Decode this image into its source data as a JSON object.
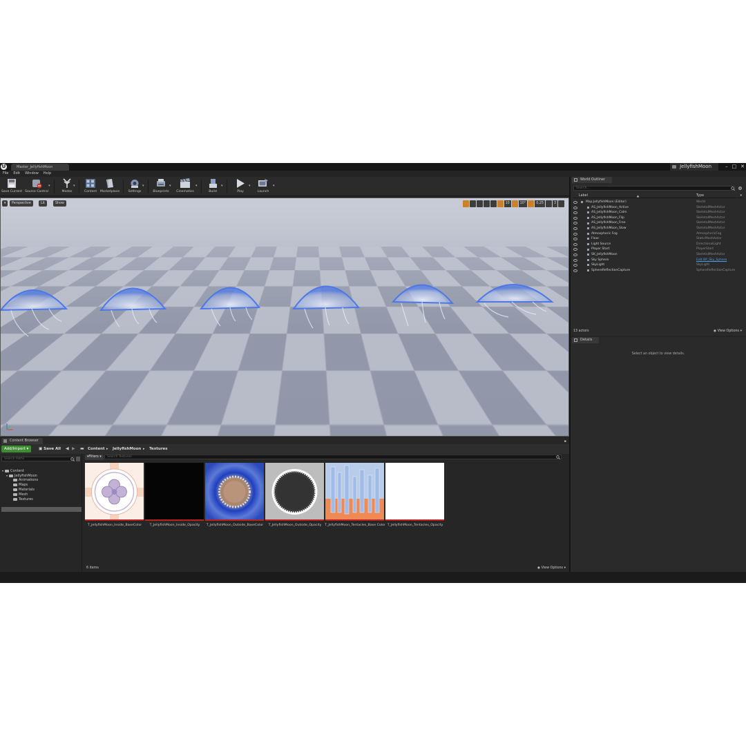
{
  "window": {
    "tab_title": "Master_JellyfishMoon",
    "project_name": "JellyfishMoon",
    "controls": [
      "–",
      "□",
      "✕"
    ]
  },
  "menu": [
    "File",
    "Edit",
    "Window",
    "Help"
  ],
  "toolbar": {
    "items": [
      {
        "label": "Save Current",
        "icon": "save-icon"
      },
      {
        "label": "Source Control",
        "icon": "source-control-icon"
      },
      {
        "label": "Modes",
        "icon": "modes-icon"
      },
      {
        "label": "Content",
        "icon": "content-icon"
      },
      {
        "label": "Marketplace",
        "icon": "marketplace-icon"
      },
      {
        "label": "Settings",
        "icon": "settings-icon"
      },
      {
        "label": "Blueprints",
        "icon": "blueprints-icon"
      },
      {
        "label": "Cinematics",
        "icon": "cinematics-icon"
      },
      {
        "label": "Build",
        "icon": "build-icon"
      },
      {
        "label": "Play",
        "icon": "play-icon"
      },
      {
        "label": "Launch",
        "icon": "launch-icon"
      }
    ]
  },
  "viewport": {
    "perspective_label": "Perspective",
    "lit_label": "Lit",
    "show_label": "Show",
    "grid_snap": "10",
    "rot_snap": "10°",
    "scale_snap": "0,25",
    "camera_speed": "3"
  },
  "outliner": {
    "tab": "World Outliner",
    "search_placeholder": "Search...",
    "col_label": "Label",
    "col_type": "Type",
    "rows": [
      {
        "label": "Map.JellyfishMoon (Editor)",
        "type": "World",
        "indent": 0,
        "link": false
      },
      {
        "label": "AS_JellyfishMoon_Active",
        "type": "SkeletalMeshActor",
        "indent": 1,
        "link": false
      },
      {
        "label": "AS_JellyfishMoon_Calm",
        "type": "SkeletalMeshActor",
        "indent": 1,
        "link": false
      },
      {
        "label": "AS_JellyfishMoon_Flip",
        "type": "SkeletalMeshActor",
        "indent": 1,
        "link": false
      },
      {
        "label": "AS_JellyfishMoon_Free",
        "type": "SkeletalMeshActor",
        "indent": 1,
        "link": false
      },
      {
        "label": "AS_JellyfishMoon_Slow",
        "type": "SkeletalMeshActor",
        "indent": 1,
        "link": false
      },
      {
        "label": "Atmospheric Fog",
        "type": "AtmosphericFog",
        "indent": 1,
        "link": false
      },
      {
        "label": "Floor",
        "type": "StaticMeshActor",
        "indent": 1,
        "link": false
      },
      {
        "label": "Light Source",
        "type": "DirectionalLight",
        "indent": 1,
        "link": false
      },
      {
        "label": "Player Start",
        "type": "PlayerStart",
        "indent": 1,
        "link": false
      },
      {
        "label": "SK_JellyfishMoon",
        "type": "SkeletalMeshActor",
        "indent": 1,
        "link": false
      },
      {
        "label": "Sky Sphere",
        "type": "Edit BP_Sky_Sphere",
        "indent": 1,
        "link": true
      },
      {
        "label": "SkyLight",
        "type": "SkyLight",
        "indent": 1,
        "link": false
      },
      {
        "label": "SphereReflectionCapture",
        "type": "SphereReflectionCapture",
        "indent": 1,
        "link": false
      }
    ],
    "actor_count": "13 actors",
    "view_options": "View Options"
  },
  "details": {
    "tab": "Details",
    "empty_message": "Select an object to view details."
  },
  "content_browser": {
    "tab": "Content Browser",
    "add_import": "Add/Import",
    "save_all": "Save All",
    "breadcrumb": [
      "Content",
      "JellyfishMoon",
      "Textures"
    ],
    "search_paths_placeholder": "Search Paths",
    "filters_label": "Filters",
    "search_textures_placeholder": "Search Textures",
    "tree": [
      {
        "label": "Content",
        "level": 0
      },
      {
        "label": "JellyfishMoon",
        "level": 1
      },
      {
        "label": "Animations",
        "level": 2
      },
      {
        "label": "Maps",
        "level": 2
      },
      {
        "label": "Materials",
        "level": 2
      },
      {
        "label": "Mesh",
        "level": 2
      },
      {
        "label": "Textures",
        "level": 2
      }
    ],
    "assets": [
      {
        "name": "T_JellyfishMoon_Inside_BaseColor",
        "style": "inside-base"
      },
      {
        "name": "T_JellyfishMoon_Inside_Opacity",
        "style": "inside-opacity"
      },
      {
        "name": "T_JellyfishMoon_Outside_BaseColor",
        "style": "outside-base"
      },
      {
        "name": "T_JellyfishMoon_Outside_Opacity",
        "style": "outside-opacity"
      },
      {
        "name": "T_JellyfishMoon_Tentacles_Base Color",
        "style": "tentacles-base"
      },
      {
        "name": "T_JellyfishMoon_Tentacles_Opacity",
        "style": "tentacles-opacity"
      }
    ],
    "item_count": "6 items",
    "view_options": "View Options"
  },
  "colors": {
    "accent_orange": "#c9822b",
    "add_button_green": "#3f8b33",
    "link_blue": "#4f9ee5",
    "thumb_underline": "#b8211e"
  }
}
